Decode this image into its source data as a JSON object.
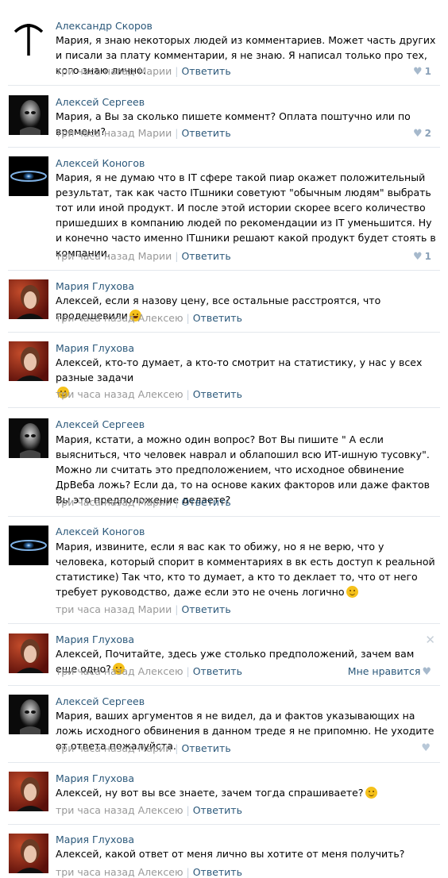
{
  "meta": {
    "time_to_mariya": "три часа назад Марии",
    "time_to_aleksey": "три часа назад Алексею",
    "reply_label": "Ответить",
    "like_label": "Мне нравится"
  },
  "comments": [
    {
      "author": "Александр Скоров",
      "text": "Мария, я знаю некоторых людей из комментариев. Может часть других и писали за плату комментарии, я не знаю. Я написал только про тех, кого знаю лично.",
      "likes": "1"
    },
    {
      "author": "Алексей Сергеев",
      "text": "Мария, а Вы за сколько пишете коммент? Оплата поштучно или по времени?",
      "likes": "2"
    },
    {
      "author": "Алексей Коногов",
      "text": "Мария, я не думаю что в IT сфере такой пиар окажет положительный результат, так как часто ITшники советуют \"обычным людям\" выбрать тот или иной продукт. И после этой истории скорее всего количество пришедших в компанию людей по рекомендации из IT уменьшится. Ну и конечно часто именно ITшники решают какой продукт будет стоять в компании.",
      "likes": "1"
    },
    {
      "author": "Мария Глухова",
      "text": "Алексей, если я назову цену, все остальные расстроятся, что продешевили"
    },
    {
      "author": "Мария Глухова",
      "text": "Алексей, кто-то думает, а кто-то смотрит на статистику, у нас у всех разные задачи"
    },
    {
      "author": "Алексей Сергеев",
      "text": "Мария, кстати, а можно один вопрос? Вот Вы пишите \" А если выясниться, что человек наврал и облапошил всю ИТ-ишную тусовку\". Можно ли считать это предположением, что исходное обвинение ДрВеба ложь? Если да, то на основе каких факторов или даже фактов Вы это предположение делаете?"
    },
    {
      "author": "Алексей Коногов",
      "text": "Мария, извините, если я вас как то обижу, но я не верю, что у человека, который спорит в комментариях в вк есть доступ к реальной статистике) Так что, кто то думает, а кто то деклает то, что от него требует руководство, даже если это не очень логично"
    },
    {
      "author": "Мария Глухова",
      "text": "Алексей, Почитайте, здесь уже столько предположений, зачем вам еще одно?"
    },
    {
      "author": "Алексей Сергеев",
      "text": "Мария, ваших аргументов я не видел, да и фактов указывающих на ложь исходного обвинения в данном треде я не припомню. Не уходите от ответа пожалуйста."
    },
    {
      "author": "Мария Глухова",
      "text": "Алексей, ну вот вы все знаете, зачем тогда спрашиваете?"
    },
    {
      "author": "Мария Глухова",
      "text": "Алексей, какой ответ от меня лично вы хотите от меня получить?"
    }
  ],
  "icons": {
    "like": "heart-icon",
    "close": "close-icon",
    "emoji_laugh": "laughing-emoji-icon",
    "emoji_wink": "wink-emoji-icon"
  },
  "colors": {
    "link": "#2b587a",
    "meta": "#999999",
    "separator": "#e4e8ed"
  }
}
